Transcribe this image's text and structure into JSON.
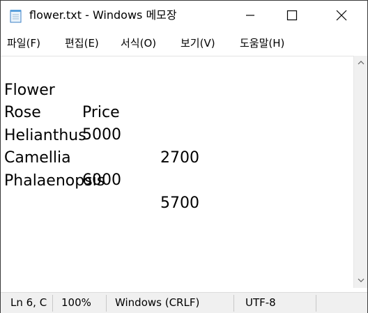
{
  "window": {
    "title": "flower.txt - Windows 메모장",
    "app_icon": "notepad-icon",
    "controls": {
      "minimize_icon": "minimize-icon",
      "maximize_icon": "maximize-icon",
      "close_icon": "close-icon"
    }
  },
  "menu": {
    "items": [
      {
        "label": "파일(F)"
      },
      {
        "label": "편집(E)"
      },
      {
        "label": "서식(O)"
      },
      {
        "label": "보기(V)"
      },
      {
        "label": "도움말(H)"
      }
    ]
  },
  "editor": {
    "lines": [
      {
        "col1": "Flower",
        "col2": "Price"
      },
      {
        "col1": "Rose",
        "col2": "5000"
      },
      {
        "col1": "Helianthus",
        "col2": "2700"
      },
      {
        "col1": "Camellia",
        "col2": "6000"
      },
      {
        "col1": "Phalaenopsis",
        "col2": "5700"
      }
    ]
  },
  "status": {
    "position": "Ln 6, C",
    "zoom": "100%",
    "line_ending": "Windows (CRLF)",
    "encoding": "UTF-8"
  }
}
